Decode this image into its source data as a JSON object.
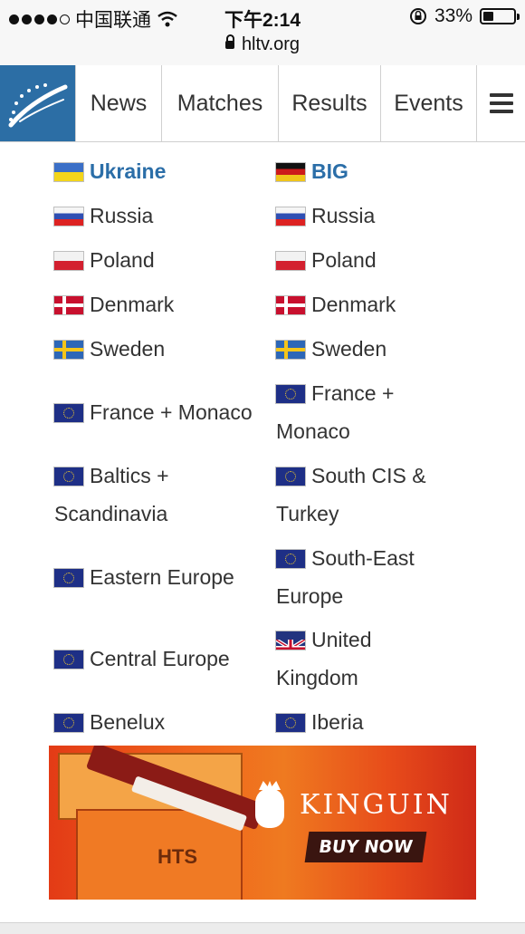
{
  "status_bar": {
    "carrier": "中国联通",
    "time": "下午2:14",
    "battery_text": "33%",
    "battery_level": 0.33,
    "url": "hltv.org"
  },
  "nav": {
    "items": [
      "News",
      "Matches",
      "Results",
      "Events"
    ],
    "logo_color": "#2c6ea5"
  },
  "regions": {
    "left": [
      {
        "label": "Ukraine",
        "flag": "flag-ua",
        "header": true
      },
      {
        "label": "Russia",
        "flag": "flag-ru"
      },
      {
        "label": "Poland",
        "flag": "flag-pl"
      },
      {
        "label": "Denmark",
        "flag": "flag-dk"
      },
      {
        "label": "Sweden",
        "flag": "flag-se"
      },
      {
        "label": "France + Monaco",
        "flag": "flag-eu"
      },
      {
        "label": "Baltics + Scandinavia",
        "flag": "flag-eu"
      },
      {
        "label": "Eastern Europe",
        "flag": "flag-eu"
      },
      {
        "label": "Central Europe",
        "flag": "flag-eu"
      },
      {
        "label": "Benelux",
        "flag": "flag-eu"
      }
    ],
    "right": [
      {
        "label": "BIG",
        "flag": "flag-de",
        "header": true
      },
      {
        "label": "Russia",
        "flag": "flag-ru"
      },
      {
        "label": "Poland",
        "flag": "flag-pl"
      },
      {
        "label": "Denmark",
        "flag": "flag-dk"
      },
      {
        "label": "Sweden",
        "flag": "flag-se"
      },
      {
        "label": "France + Monaco",
        "flag": "flag-eu"
      },
      {
        "label": "South CIS & Turkey",
        "flag": "flag-eu"
      },
      {
        "label": "South-East Europe",
        "flag": "flag-eu"
      },
      {
        "label": "United Kingdom",
        "flag": "flag-gb"
      },
      {
        "label": "Iberia",
        "flag": "flag-eu"
      }
    ]
  },
  "ad": {
    "brand": "KINGUIN",
    "cta": "BUY NOW",
    "case_label": "HTS"
  },
  "colors": {
    "accent": "#2b6ea8"
  }
}
